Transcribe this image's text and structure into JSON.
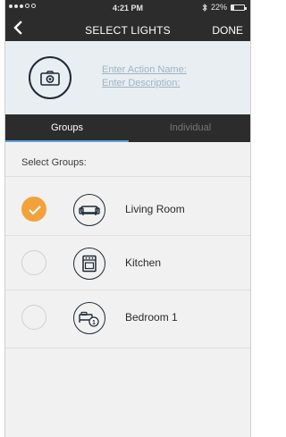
{
  "status_bar": {
    "time": "4:21 PM",
    "battery": "22%",
    "battery_fraction": 0.22,
    "signal_bars_filled": 3,
    "signal_bars_total": 5
  },
  "nav": {
    "back_icon": "chevron-left-icon",
    "title": "SELECT LIGHTS",
    "done_label": "DONE"
  },
  "action": {
    "icon": "camera-icon",
    "name_placeholder": "Enter Action Name:",
    "description_placeholder": "Enter Description:"
  },
  "tabs": [
    {
      "label": "Groups",
      "active": true
    },
    {
      "label": "Individual",
      "active": false
    }
  ],
  "list": {
    "section_label": "Select Groups:",
    "items": [
      {
        "label": "Living Room",
        "checked": true,
        "icon": "sofa-icon"
      },
      {
        "label": "Kitchen",
        "checked": false,
        "icon": "oven-icon"
      },
      {
        "label": "Bedroom 1",
        "checked": false,
        "icon": "bed-icon"
      }
    ]
  },
  "colors": {
    "accent_orange": "#f2a23c",
    "tab_underline": "#5aa1e0",
    "dark_bar": "#2c2c2c",
    "placeholder": "#9fb3c2"
  }
}
